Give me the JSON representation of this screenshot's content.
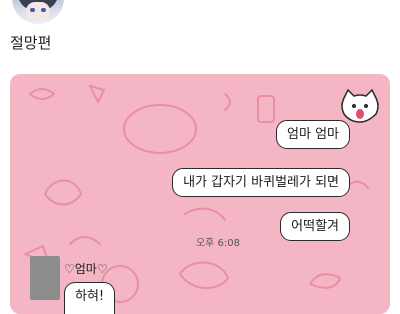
{
  "post": {
    "username": "절망편"
  },
  "chat": {
    "background_color": "#f4b6c5",
    "messages_out": [
      "엄마 엄마",
      "내가 갑자기 바퀴벌레가 되면",
      "어떡할겨"
    ],
    "timestamp": "오후 6:08",
    "contact_name": "♡엄마♡",
    "messages_in": [
      "하혀!"
    ]
  },
  "icons": {
    "avatar": "profile-avatar",
    "sticker": "cat-sticker-icon"
  }
}
